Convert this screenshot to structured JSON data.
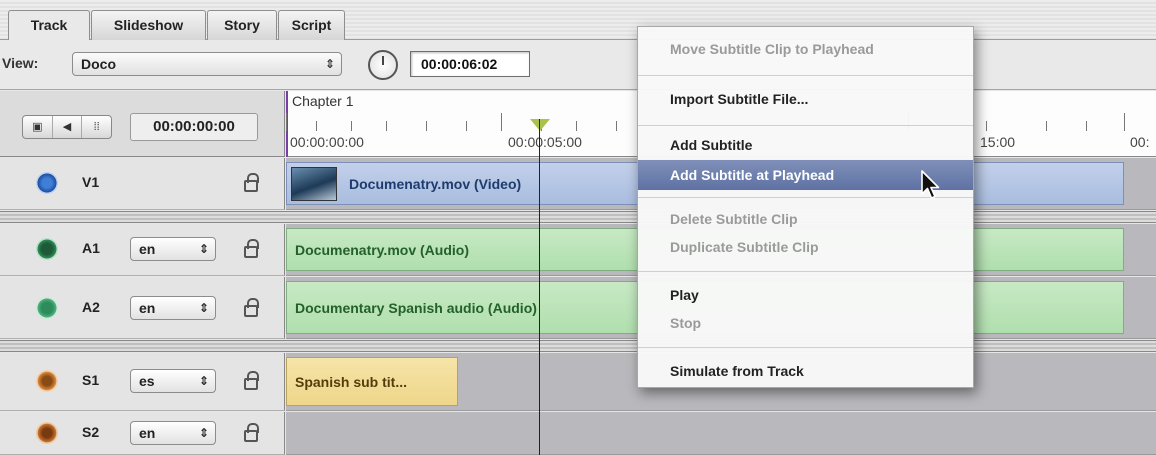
{
  "tabs": [
    "Track",
    "Slideshow",
    "Story",
    "Script"
  ],
  "active_tab": "Track",
  "view_label": "View:",
  "view_value": "Doco",
  "timecode_current": "00:00:06:02",
  "timecode_left": "00:00:00:00",
  "ruler": {
    "chapter": "Chapter 1",
    "labels": [
      "00:00:00:00",
      "00:00:05:00",
      "15:00",
      "00:"
    ]
  },
  "tracks": [
    {
      "name": "V1",
      "lang": "",
      "clip": "Documenatry.mov (Video)",
      "type": "video"
    },
    {
      "name": "A1",
      "lang": "en",
      "clip": "Documenatry.mov (Audio)",
      "type": "audio"
    },
    {
      "name": "A2",
      "lang": "en",
      "clip": "Documentary Spanish audio (Audio)",
      "type": "audio"
    },
    {
      "name": "S1",
      "lang": "es",
      "clip": "Spanish sub tit...",
      "type": "subtitle"
    },
    {
      "name": "S2",
      "lang": "en",
      "clip": "",
      "type": "subtitle"
    }
  ],
  "menu": {
    "items": [
      {
        "label": "Move Subtitle Clip to Playhead",
        "enabled": false
      },
      {
        "label": "Import Subtitle File...",
        "enabled": true
      },
      {
        "label": "Add Subtitle",
        "enabled": true
      },
      {
        "label": "Add Subtitle at Playhead",
        "enabled": true,
        "highlighted": true
      },
      {
        "label": "Delete Subtitle Clip",
        "enabled": false
      },
      {
        "label": "Duplicate Subtitle Clip",
        "enabled": false
      },
      {
        "label": "Play",
        "enabled": true
      },
      {
        "label": "Stop",
        "enabled": false
      },
      {
        "label": "Simulate from Track",
        "enabled": true
      }
    ]
  },
  "colors": {
    "video_clip": "#a9bddf",
    "audio_clip": "#b0dfae",
    "subtitle_clip": "#eed68a",
    "menu_highlight": "#6a7cab",
    "playhead_marker": "#a9c24a"
  }
}
